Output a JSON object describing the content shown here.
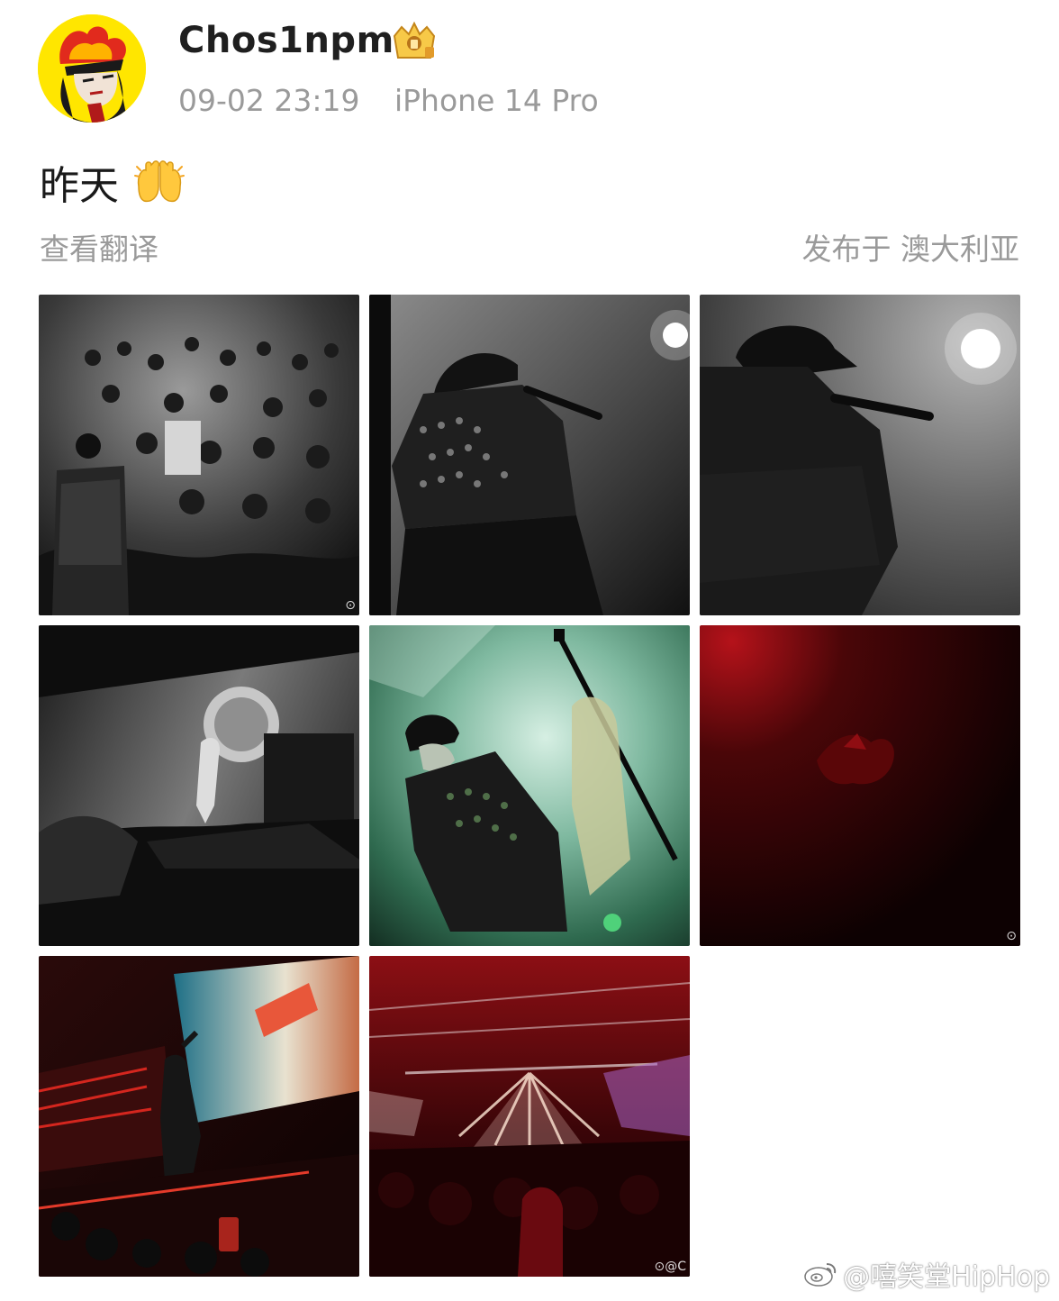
{
  "post": {
    "username": "Chos1npm",
    "date": "09-02 23:19",
    "device": "iPhone 14 Pro",
    "text": "昨天",
    "translate_label": "查看翻译",
    "location": "发布于 澳大利亚"
  },
  "photos": [
    {
      "name": "photo-crowd-bw",
      "watermark": "⊙"
    },
    {
      "name": "photo-rapper-mic-bw",
      "watermark": ""
    },
    {
      "name": "photo-rapper-closeup-bw",
      "watermark": ""
    },
    {
      "name": "photo-stage-bw",
      "watermark": ""
    },
    {
      "name": "photo-green-stage",
      "watermark": ""
    },
    {
      "name": "photo-red-dark",
      "watermark": "⊙"
    },
    {
      "name": "photo-red-stage-screen",
      "watermark": ""
    },
    {
      "name": "photo-red-lights-venue",
      "watermark": "⊙@C"
    }
  ],
  "overlay_watermark": "@嘻笑堂HipHop"
}
